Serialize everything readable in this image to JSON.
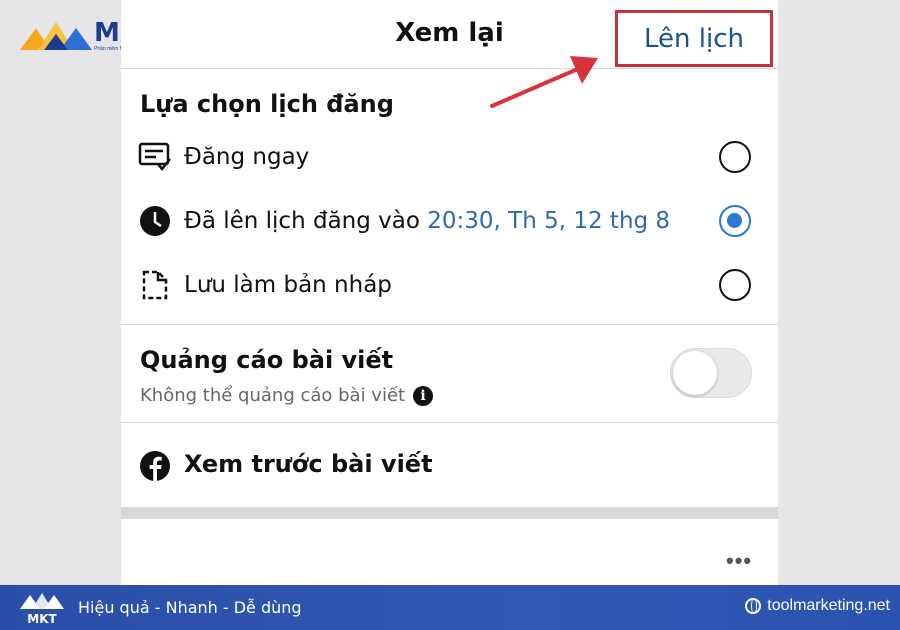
{
  "logo": {
    "word": "MKT",
    "tagline": "Phần mềm Marketing đa kênh"
  },
  "header": {
    "title": "Xem lại",
    "schedule_button": "Lên lịch"
  },
  "schedule": {
    "section_title": "Lựa chọn lịch đăng",
    "options": [
      {
        "label": "Đăng ngay",
        "icon": "post-now-icon",
        "selected": false
      },
      {
        "label": "Đã lên lịch đăng vào",
        "time": "20:30, Th 5, 12 thg 8",
        "icon": "clock-icon",
        "selected": true
      },
      {
        "label": "Lưu làm bản nháp",
        "icon": "draft-document-icon",
        "selected": false
      }
    ]
  },
  "boost": {
    "title": "Quảng cáo bài viết",
    "subtitle": "Không thể quảng cáo bài viết",
    "info_glyph": "i",
    "enabled": false
  },
  "preview": {
    "label": "Xem trước bài viết",
    "icon": "facebook-icon"
  },
  "more_glyph": "•••",
  "banner": {
    "logo_word": "MKT",
    "slogan": "Hiệu quả - Nhanh  - Dễ dùng",
    "website": "toolmarketing.net"
  },
  "colors": {
    "accent_blue": "#2a7ad0",
    "time_text": "#2f6ba8",
    "highlight_red": "#c8303b",
    "banner_blue": "#2b4fa8"
  }
}
